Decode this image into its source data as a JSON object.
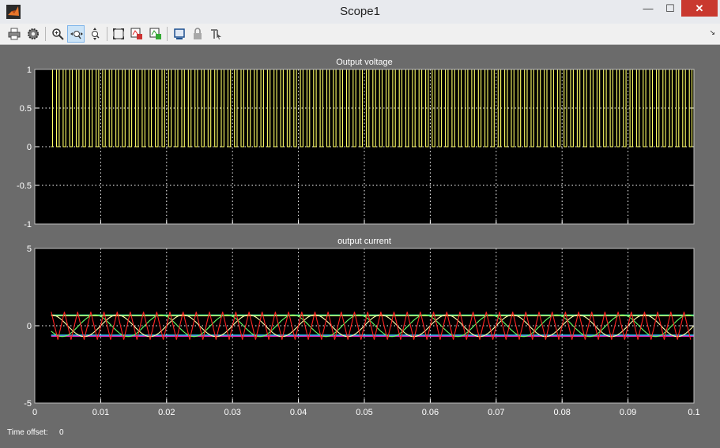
{
  "window": {
    "title": "Scope1"
  },
  "toolbar": {
    "buttons": [
      "print",
      "parameters",
      "zoom",
      "zoom-x-axis",
      "zoom-y-axis",
      "autoscale",
      "save-axes-settings",
      "restore-axes-settings",
      "floating-scope",
      "lock-axes-selection",
      "signal-selection"
    ],
    "active": "zoom-x-axis"
  },
  "colors": {
    "background": "#000000",
    "frame": "#6b6b6b",
    "text": "#ffffff",
    "grid": "#ffffff"
  },
  "time_offset": {
    "label": "Time offset:",
    "value": "0"
  },
  "chart_data": [
    {
      "type": "line",
      "title": "Output voltage",
      "xlim": [
        0,
        0.1
      ],
      "ylim": [
        -1,
        1
      ],
      "yticks": [
        "1",
        "0.5",
        "0",
        "-0.5",
        "-1"
      ],
      "yticks_values": [
        1,
        0.5,
        0,
        -0.5,
        -1
      ],
      "grid": true,
      "series": [
        {
          "color": "#ffff66",
          "kind": "pwm",
          "x_start": 0.0025,
          "period": 0.001,
          "low": 0,
          "high": 1
        }
      ]
    },
    {
      "type": "line",
      "title": "output current",
      "xlim": [
        0,
        0.1
      ],
      "ylim": [
        -5,
        5
      ],
      "yticks": [
        "5",
        "0",
        "-5"
      ],
      "yticks_values": [
        5,
        0,
        -5
      ],
      "xticks": [
        "0",
        "0.01",
        "0.02",
        "0.03",
        "0.04",
        "0.05",
        "0.06",
        "0.07",
        "0.08",
        "0.09",
        "0.1"
      ],
      "xticks_values": [
        0,
        0.01,
        0.02,
        0.03,
        0.04,
        0.05,
        0.06,
        0.07,
        0.08,
        0.09,
        0.1
      ],
      "grid": true,
      "series": [
        {
          "color": "#ffff66",
          "kind": "dc",
          "x_start": 0.0025,
          "value": 0.65
        },
        {
          "color": "#44ffaa",
          "kind": "dc",
          "x_start": 0.0025,
          "value": 0.7
        },
        {
          "color": "#5566ff",
          "kind": "dc",
          "x_start": 0.0025,
          "value": -0.65
        },
        {
          "color": "#22ddff",
          "kind": "dc",
          "x_start": 0.0025,
          "value": -0.6
        },
        {
          "color": "#ff33cc",
          "kind": "dc",
          "x_start": 0.0025,
          "value": -0.68
        },
        {
          "color": "#ffffaa",
          "kind": "sine",
          "x_start": 0.0025,
          "amplitude": 0.7,
          "period": 0.01
        },
        {
          "color": "#66ff66",
          "kind": "sine",
          "x_start": 0.0025,
          "amplitude": 0.7,
          "period": 0.01,
          "phase": 2.1
        },
        {
          "color": "#ff2222",
          "kind": "triangle",
          "x_start": 0.0025,
          "amplitude": 0.9,
          "period": 0.002
        }
      ]
    }
  ]
}
